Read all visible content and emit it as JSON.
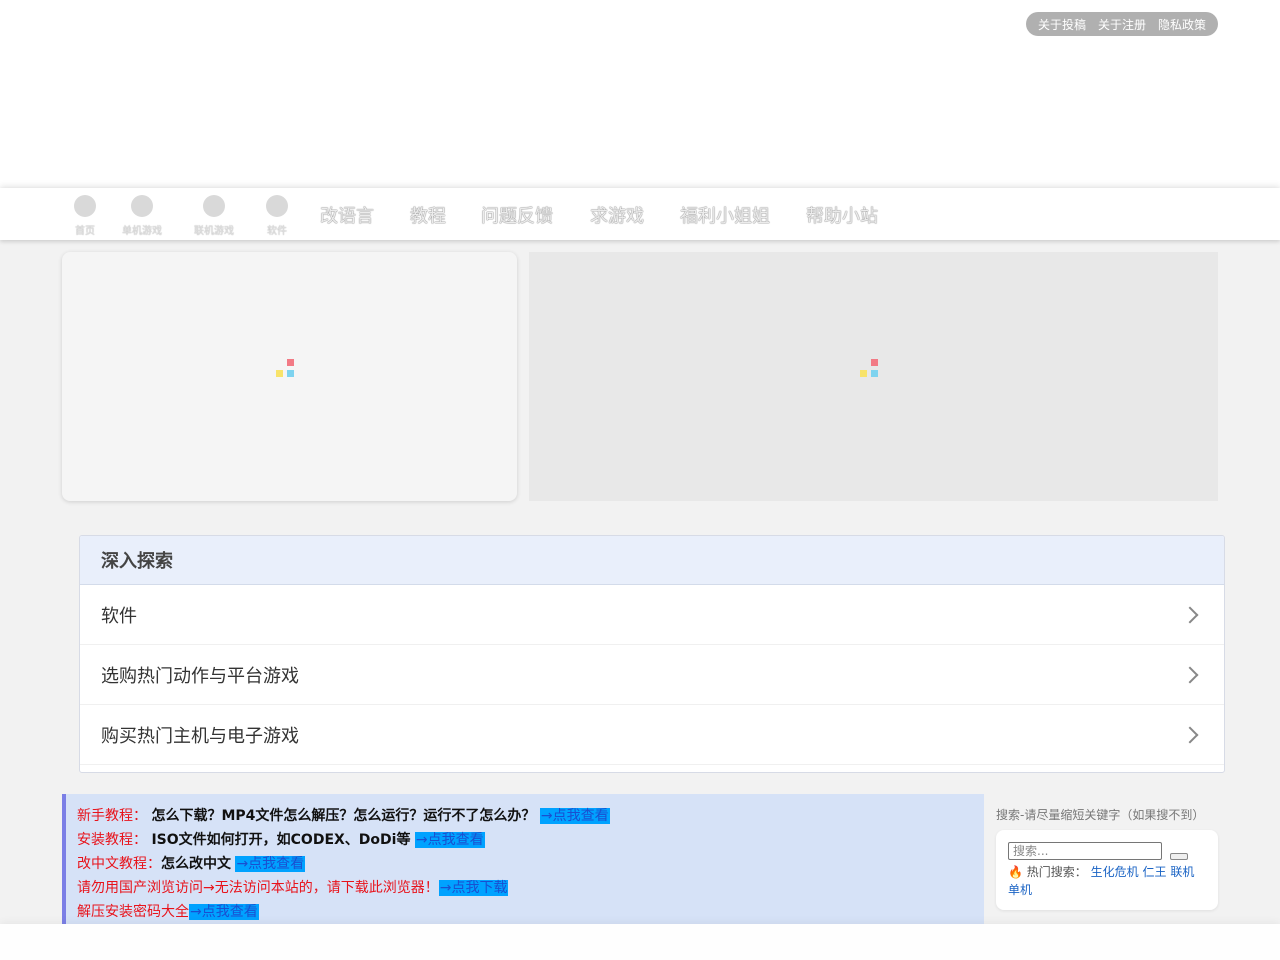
{
  "header": {
    "top_links": [
      "关于投稿",
      "关于注册",
      "隐私政策"
    ]
  },
  "nav": {
    "icon_items": [
      {
        "label": "首页",
        "icon": "home-icon"
      },
      {
        "label": "单机游戏",
        "icon": "single-game-icon"
      },
      {
        "label": "联机游戏",
        "icon": "online-game-icon"
      },
      {
        "label": "软件",
        "icon": "software-icon"
      }
    ],
    "text_items": [
      "改语言",
      "教程",
      "问题反馈",
      "求游戏",
      "福利小姐姐",
      "帮助小站"
    ]
  },
  "explore": {
    "title": "深入探索",
    "items": [
      "软件",
      "选购热门动作与平台游戏",
      "购买热门主机与电子游戏"
    ]
  },
  "notice": {
    "lines": [
      {
        "label": "新手教程：",
        "text": "怎么下载？MP4文件怎么解压？怎么运行？运行不了怎么办？",
        "link": "→点我查看"
      },
      {
        "label": "安装教程：",
        "text": "ISO文件如何打开，如CODEX、DoDi等",
        "link": "→点我查看"
      },
      {
        "label": "改中文教程：",
        "text": "怎么改中文",
        "link": "→点我查看"
      },
      {
        "label": "请勿用国产浏览访问→无法访问本站的，请下载此浏览器！",
        "text": "",
        "link": "→点我下载"
      },
      {
        "label": "解压安装密码大全",
        "text": "",
        "link": "→点我查看"
      }
    ]
  },
  "search": {
    "title": "搜索-请尽量缩短关键字（如果搜不到）",
    "placeholder": "搜索...",
    "hot_label": "热门搜索：",
    "hot_icon": "fire-icon",
    "hot_keywords": [
      "生化危机",
      "仁王",
      "联机",
      "单机"
    ]
  },
  "colors": {
    "notice_bg": "#d6e2f7",
    "notice_border": "#7b7fe6",
    "notice_red": "#e8131b",
    "link_bg": "#00a2ff",
    "explore_head_bg": "#e9effb",
    "top_links_bg": "#b0b0b0"
  }
}
